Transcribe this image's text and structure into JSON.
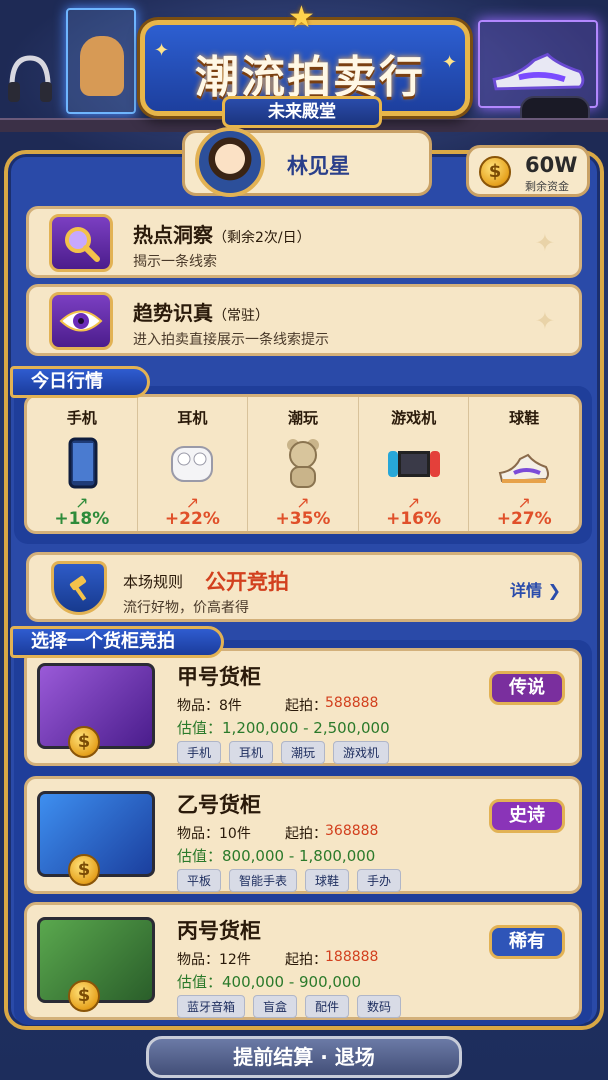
{
  "header": {
    "title": "潮流拍卖行",
    "subtitle": "未来殿堂"
  },
  "player": {
    "name": "林见星",
    "funds": "60W",
    "funds_label": "剩余资金"
  },
  "skills": [
    {
      "title": "热点洞察",
      "note": "（剩余2次/日）",
      "desc": "揭示一条线索",
      "icon": "magnifier-icon"
    },
    {
      "title": "趋势识真",
      "note": "（常驻）",
      "desc": "进入拍卖直接展示一条线索提示",
      "icon": "eye-icon"
    }
  ],
  "market": {
    "heading": "今日行情",
    "items": [
      {
        "name": "手机",
        "change": "+18%",
        "color": "#2e8b3a",
        "icon": "phone-icon"
      },
      {
        "name": "耳机",
        "change": "+22%",
        "color": "#e0502a",
        "icon": "earbuds-icon"
      },
      {
        "name": "潮玩",
        "change": "+35%",
        "color": "#e0502a",
        "icon": "bear-toy-icon"
      },
      {
        "name": "游戏机",
        "change": "+16%",
        "color": "#e0502a",
        "icon": "game-console-icon"
      },
      {
        "name": "球鞋",
        "change": "+27%",
        "color": "#e0502a",
        "icon": "sneaker-icon"
      }
    ]
  },
  "rule": {
    "label": "本场规则",
    "value": "公开竞拍",
    "desc": "流行好物，价高者得",
    "detail": "详情 ❯"
  },
  "cabinets": {
    "heading": "选择一个货柜竞拍",
    "items_label": "物品：",
    "start_label": "起拍：",
    "est_label": "估值：",
    "list": [
      {
        "name": "甲号货柜",
        "items": "8件",
        "start": "588888",
        "est": "1,200,000 - 2,500,000",
        "tags": [
          "手机",
          "耳机",
          "潮玩",
          "游戏机"
        ],
        "rarity": "传说",
        "rarity_color": "#7a2f9e",
        "box_color": "#7b3fc2"
      },
      {
        "name": "乙号货柜",
        "items": "10件",
        "start": "368888",
        "est": "800,000 - 1,800,000",
        "tags": [
          "平板",
          "智能手表",
          "球鞋",
          "手办"
        ],
        "rarity": "史诗",
        "rarity_color": "#8a34b8",
        "box_color": "#2f6fd6"
      },
      {
        "name": "丙号货柜",
        "items": "12件",
        "start": "188888",
        "est": "400,000 - 900,000",
        "tags": [
          "蓝牙音箱",
          "盲盒",
          "配件",
          "数码"
        ],
        "rarity": "稀有",
        "rarity_color": "#2f55b8",
        "box_color": "#3f8a3c"
      }
    ]
  },
  "footer": {
    "exit_label": "提前结算 · 退场"
  }
}
